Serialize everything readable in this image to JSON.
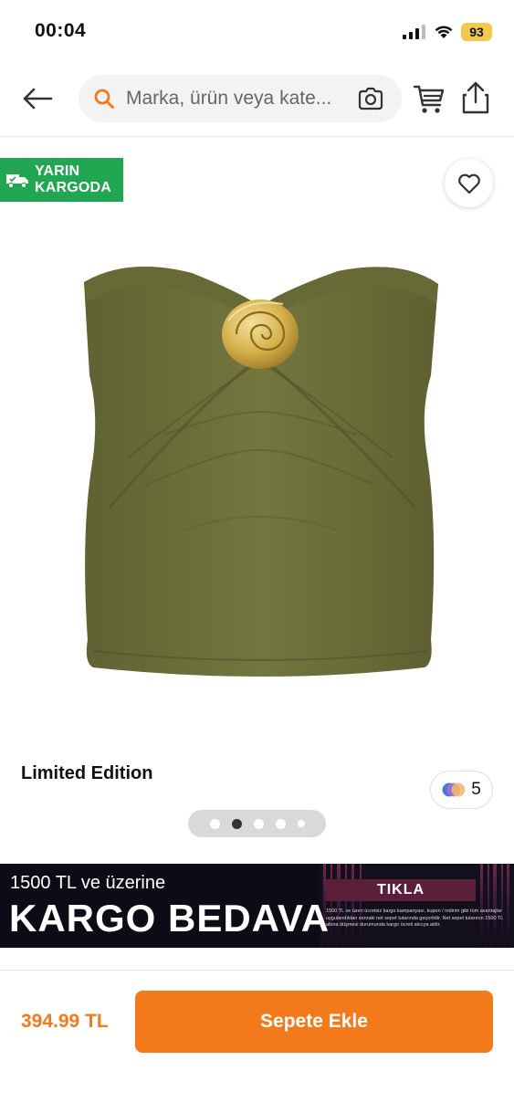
{
  "status_bar": {
    "time": "00:04",
    "battery": "93"
  },
  "search": {
    "placeholder": "Marka, ürün veya kate..."
  },
  "badge": {
    "line1": "YARIN",
    "line2": "KARGODA"
  },
  "product": {
    "edition_label": "Limited Edition",
    "color_count": "5",
    "image_icon": "olive-strapless-top-with-shell-brooch"
  },
  "pager": {
    "total": 5,
    "active_index": 1
  },
  "banner": {
    "small": "1500 TL ve üzerine",
    "big": "KARGO BEDAVA",
    "cta": "TIKLA",
    "terms": "1500 TL ve üzeri ücretsiz kargo kampanyası, kupon / indirim gibi tüm avantajlar uygulandıktan sonraki net sepet tutarında geçerlidir. Net sepet tutarının 1500 TL altına düşmesi durumunda kargo ücreti alıcıya aittir."
  },
  "bottom": {
    "price": "394.99 TL",
    "add_to_cart": "Sepete Ekle"
  },
  "colors": {
    "brand_orange": "#f27a1a",
    "badge_green": "#21a651",
    "product_olive": "#6b6b3a",
    "brooch_gold": "#d4b04a"
  }
}
